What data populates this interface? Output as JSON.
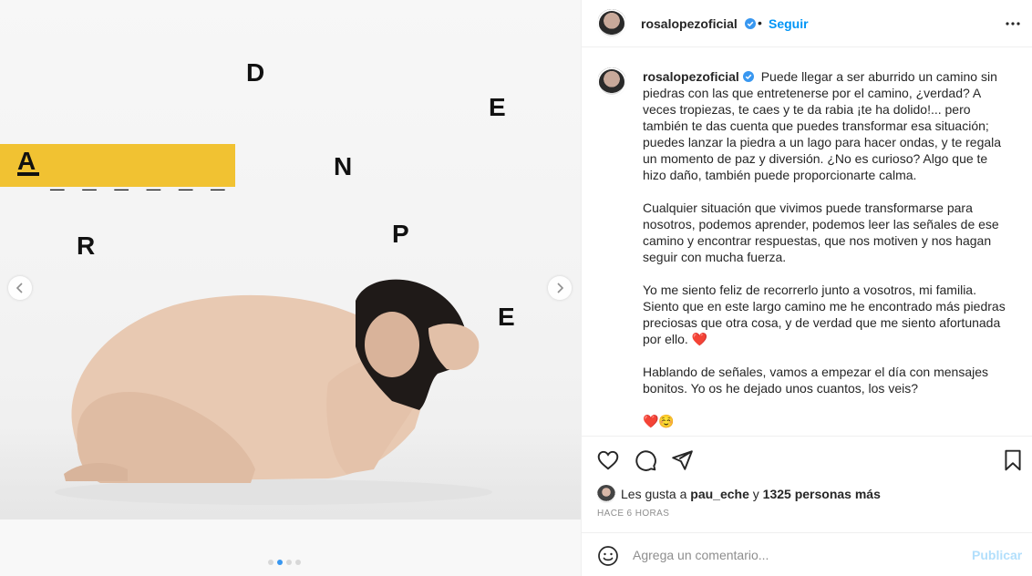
{
  "media": {
    "letters": {
      "a": "A",
      "d": "D",
      "e1": "E",
      "n": "N",
      "r": "R",
      "p": "P",
      "e2": "E"
    },
    "blanks": "_ _ _ _ _ _",
    "slide_dots": 4,
    "active_dot": 1,
    "accent_yellow": "#f1c232"
  },
  "post": {
    "username": "rosalopezoficial",
    "follow_label": "Seguir",
    "dot": "•",
    "caption": {
      "username": "rosalopezoficial",
      "p1": "Puede llegar a ser aburrido un camino sin piedras con las que entretenerse por el camino, ¿verdad? A veces tropiezas, te caes y te da rabia ¡te ha dolido!... pero también te das cuenta que puedes transformar esa situación; puedes lanzar la piedra a un lago para hacer ondas, y te regala un momento de paz y diversión. ¿No es curioso? Algo que te hizo daño, también puede proporcionarte calma.",
      "p2": "Cualquier situación que vivimos puede transformarse para nosotros, podemos aprender, podemos leer las señales de ese camino y encontrar respuestas, que nos motiven y nos hagan seguir con mucha fuerza.",
      "p3": "Yo me siento feliz de recorrerlo junto a vosotros, mi familia. Siento que en este largo camino me he encontrado más piedras preciosas que otra cosa, y de verdad que me siento afortunada por ello. ❤️",
      "p4": "Hablando de señales, vamos a empezar el día con mensajes bonitos. Yo os he dejado unos cuantos, los veis?",
      "p5": "❤️☺️"
    },
    "likes": {
      "prefix": "Les gusta a",
      "user": "pau_eche",
      "conj": "y",
      "others": "1325 personas más"
    },
    "time": "HACE 6 HORAS",
    "comment": {
      "placeholder": "Agrega un comentario...",
      "publish_label": "Publicar"
    },
    "colors": {
      "link_blue": "#0095f6",
      "publish_disabled": "#b2dffc",
      "verified_blue": "#3897f0"
    }
  }
}
